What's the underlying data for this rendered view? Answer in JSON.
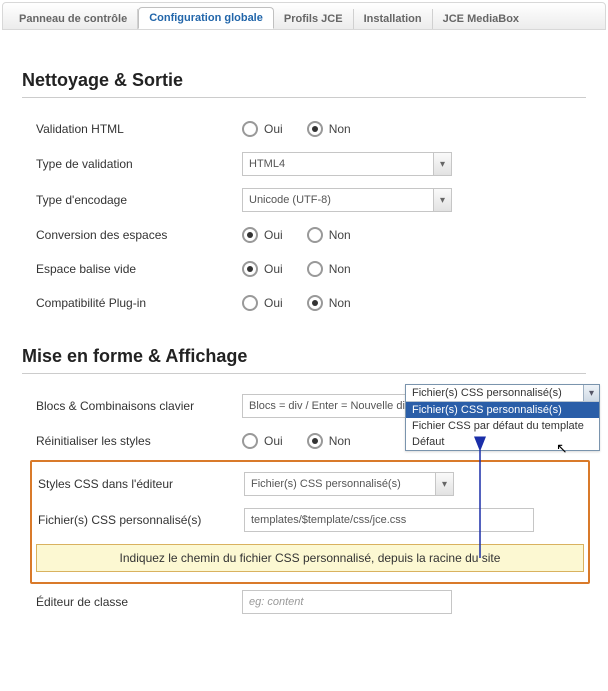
{
  "tabs": {
    "panel": "Panneau de contrôle",
    "global": "Configuration globale",
    "profiles": "Profils JCE",
    "install": "Installation",
    "mediabox": "JCE MediaBox"
  },
  "sections": {
    "cleanup": "Nettoyage & Sortie",
    "format": "Mise en forme & Affichage"
  },
  "labels": {
    "yes": "Oui",
    "no": "Non",
    "validation_html": "Validation HTML",
    "validation_type": "Type de validation",
    "encoding_type": "Type d'encodage",
    "space_conv": "Conversion des espaces",
    "empty_tag": "Espace balise vide",
    "plugin_compat": "Compatibilité Plug-in",
    "blocks_keys": "Blocs & Combinaisons clavier",
    "reset_styles": "Réinitialiser les styles",
    "css_in_editor": "Styles CSS dans l'éditeur",
    "custom_css_files": "Fichier(s) CSS personnalisé(s)",
    "class_editor": "Éditeur de classe"
  },
  "values": {
    "validation_type": "HTML4",
    "encoding_type": "Unicode (UTF-8)",
    "blocks_keys": "Blocs = div / Enter = Nouvelle div / :",
    "css_in_editor": "Fichier(s) CSS personnalisé(s)",
    "custom_css_files": "templates/$template/css/jce.css",
    "class_editor_placeholder": "eg: content"
  },
  "dropdown": {
    "header": "Fichier(s) CSS personnalisé(s)",
    "opt_custom": "Fichier(s) CSS personnalisé(s)",
    "opt_template": "Fichier CSS par défaut du template",
    "opt_default": "Défaut"
  },
  "callout": "Indiquez le chemin du fichier CSS personnalisé, depuis la racine du site"
}
